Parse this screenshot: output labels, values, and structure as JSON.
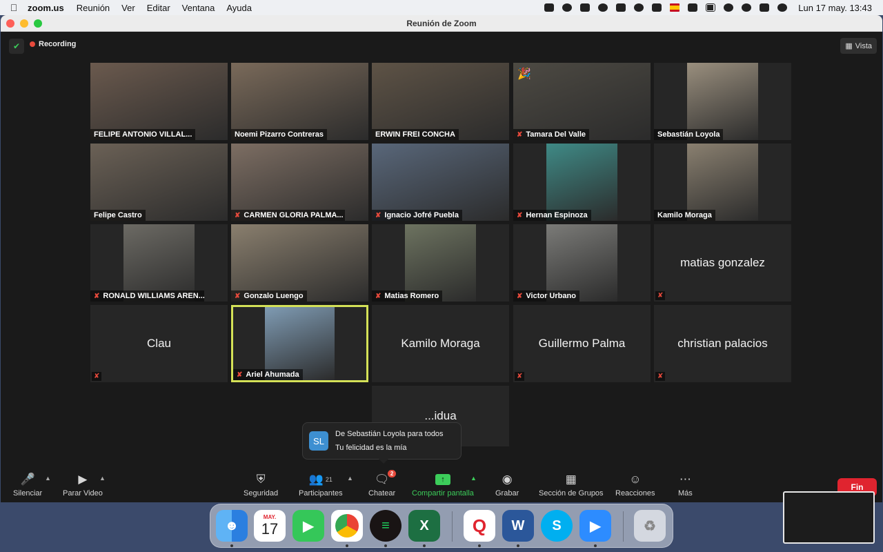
{
  "menubar": {
    "app": "zoom.us",
    "items": [
      "Reunión",
      "Ver",
      "Editar",
      "Ventana",
      "Ayuda"
    ],
    "clock": "Lun 17 may.  13:43"
  },
  "window": {
    "title": "Reunión de Zoom",
    "recording": "Recording",
    "view": "Vista"
  },
  "tiles": [
    {
      "name": "FELIPE ANTONIO VILLAL...",
      "muted": false,
      "video": true,
      "bg": "#6b5a4e"
    },
    {
      "name": "Noemi Pizarro Contreras",
      "muted": false,
      "video": true,
      "bg": "#7a6a5a"
    },
    {
      "name": "ERWIN FREI CONCHA",
      "muted": false,
      "video": true,
      "bg": "#5e5346"
    },
    {
      "name": "Tamara Del Valle",
      "muted": true,
      "video": true,
      "bg": "#4d4a43",
      "reaction": "🎉"
    },
    {
      "name": "Sebastián Loyola",
      "muted": false,
      "video": true,
      "bg": "#9a8f7e",
      "narrow": true
    },
    {
      "name": "Felipe Castro",
      "muted": false,
      "video": true,
      "bg": "#6b6156"
    },
    {
      "name": "CARMEN GLORIA PALMA...",
      "muted": true,
      "video": true,
      "bg": "#7d6e63"
    },
    {
      "name": "Ignacio Jofré Puebla",
      "muted": true,
      "video": true,
      "bg": "#59677a"
    },
    {
      "name": "Hernan Espinoza",
      "muted": true,
      "video": true,
      "bg": "#3f8a86",
      "narrow": true
    },
    {
      "name": "Kamilo Moraga",
      "muted": false,
      "video": true,
      "bg": "#8a8070",
      "narrow": true
    },
    {
      "name": "RONALD WILLIAMS AREN...",
      "muted": true,
      "video": true,
      "bg": "#6c6a64",
      "narrow": true
    },
    {
      "name": "Gonzalo Luengo",
      "muted": true,
      "video": true,
      "bg": "#8a7f6e"
    },
    {
      "name": "Matias Romero",
      "muted": true,
      "video": true,
      "bg": "#6d7360",
      "narrow": true
    },
    {
      "name": "Victor Urbano",
      "muted": true,
      "video": true,
      "bg": "#7b7b78",
      "narrow": true
    },
    {
      "name": "matias gonzalez",
      "muted": true,
      "video": false
    },
    {
      "name": "Clau",
      "muted": true,
      "video": false
    },
    {
      "name": "Ariel Ahumada",
      "muted": true,
      "video": true,
      "bg": "#7f9bb3",
      "narrow": true,
      "active": true
    },
    {
      "name": "Kamilo Moraga",
      "muted": false,
      "video": false
    },
    {
      "name": "Guillermo Palma",
      "muted": true,
      "video": false
    },
    {
      "name": "christian palacios",
      "muted": true,
      "video": false
    },
    {
      "name": "...idua",
      "muted": false,
      "video": false
    }
  ],
  "toast": {
    "initials": "SL",
    "from": "De Sebastián Loyola para todos",
    "message": "Tu felicidad es la mía"
  },
  "toolbar": {
    "mute": "Silenciar",
    "stop_video": "Parar Video",
    "security": "Seguridad",
    "participants": "Participantes",
    "participants_count": "21",
    "chat": "Chatear",
    "chat_badge": "2",
    "share": "Compartir pantalla",
    "record": "Grabar",
    "breakout": "Sección de Grupos",
    "reactions": "Reacciones",
    "more": "Más",
    "end": "Fin"
  },
  "dock": {
    "calendar_month": "MAY.",
    "calendar_day": "17",
    "apps": [
      "finder",
      "calendar",
      "facetime",
      "chrome",
      "spotify",
      "excel",
      "quip",
      "word",
      "skype",
      "zoom",
      "trash"
    ]
  }
}
